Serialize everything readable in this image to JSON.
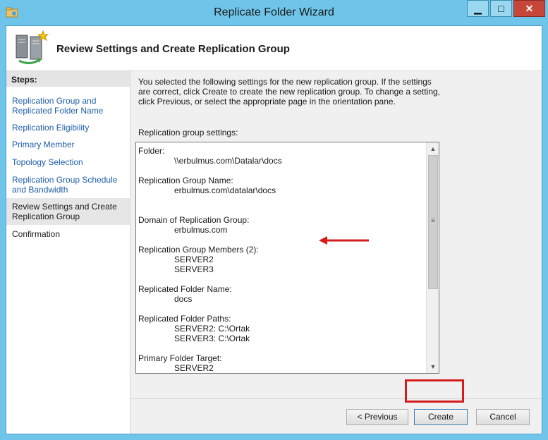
{
  "window": {
    "title": "Replicate Folder Wizard",
    "controls": {
      "minimize": "▁",
      "maximize": "□",
      "close": "✕"
    }
  },
  "header": {
    "title": "Review Settings and Create Replication Group"
  },
  "steps": {
    "label": "Steps:",
    "items": [
      {
        "label": "Replication Group and Replicated Folder Name"
      },
      {
        "label": "Replication Eligibility"
      },
      {
        "label": "Primary Member"
      },
      {
        "label": "Topology Selection"
      },
      {
        "label": "Replication Group Schedule and Bandwidth"
      },
      {
        "label": "Review Settings and Create Replication Group"
      },
      {
        "label": "Confirmation"
      }
    ]
  },
  "main": {
    "intro": "You selected the following settings for the new replication group. If the settings are correct, click Create to create the new replication group. To change a setting, click Previous, or select the appropriate page in the orientation pane.",
    "settings_label": "Replication group settings:",
    "settings": {
      "folder_label": "Folder:",
      "folder_value": "\\\\erbulmus.com\\Datalar\\docs",
      "group_name_label": "Replication Group Name:",
      "group_name_value": "erbulmus.com\\datalar\\docs",
      "domain_label": "Domain of Replication Group:",
      "domain_value": "erbulmus.com",
      "members_label": "Replication Group Members (2):",
      "members": [
        "SERVER2",
        "SERVER3"
      ],
      "folder_name_label": "Replicated Folder Name:",
      "folder_name_value": "docs",
      "paths_label": "Replicated Folder Paths:",
      "paths": [
        "SERVER2: C:\\Ortak",
        "SERVER3: C:\\Ortak"
      ],
      "primary_label": "Primary Folder Target:",
      "primary_value": "SERVER2"
    }
  },
  "buttons": {
    "previous": "< Previous",
    "create": "Create",
    "cancel": "Cancel"
  },
  "colors": {
    "accent": "#6fc5e9",
    "link": "#1f5fa8",
    "annotation": "#d41c1c"
  }
}
